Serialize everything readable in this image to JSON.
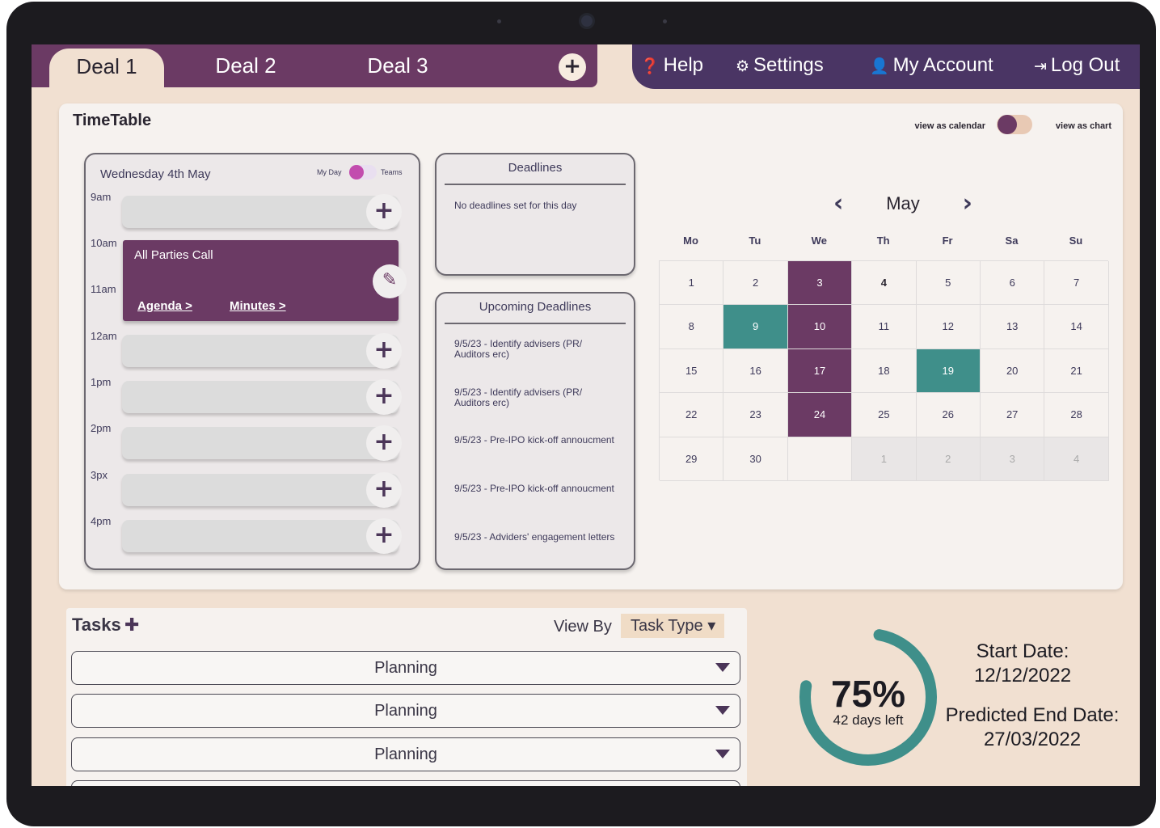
{
  "tabs": {
    "deal1": "Deal 1",
    "deal2": "Deal 2",
    "deal3": "Deal 3",
    "add": "+"
  },
  "nav": {
    "help": "Help",
    "settings": "Settings",
    "account": "My Account",
    "logout": "Log Out"
  },
  "timetable": {
    "title": "TimeTable",
    "view_calendar": "view as calendar",
    "view_chart": "view as chart"
  },
  "day": {
    "date": "Wednesday 4th May",
    "mode_left": "My Day",
    "mode_right": "Teams",
    "hours": [
      "9am",
      "10am",
      "11am",
      "12am",
      "1pm",
      "2pm",
      "3px",
      "4pm"
    ],
    "event": {
      "title": "All Parties Call",
      "agenda": "Agenda >",
      "minutes": "Minutes >"
    }
  },
  "deadlines": {
    "title": "Deadlines",
    "empty": "No deadlines set for this day"
  },
  "upcoming": {
    "title": "Upcoming Deadlines",
    "items": [
      "9/5/23 - Identify advisers (PR/ Auditors erc)",
      "9/5/23 - Identify advisers (PR/ Auditors erc)",
      "9/5/23 - Pre-IPO kick-off annoucment",
      "9/5/23 - Pre-IPO kick-off annoucment",
      "9/5/23 - Adviders' engagement letters"
    ]
  },
  "calendar": {
    "month": "May",
    "prev": "‹",
    "next": "›",
    "weekdays": [
      "Mo",
      "Tu",
      "We",
      "Th",
      "Fr",
      "Sa",
      "Su"
    ],
    "weeks": [
      [
        "1",
        "2",
        "3",
        "4",
        "5",
        "6",
        "7"
      ],
      [
        "8",
        "9",
        "10",
        "11",
        "12",
        "13",
        "14"
      ],
      [
        "15",
        "16",
        "17",
        "18",
        "19",
        "20",
        "21"
      ],
      [
        "22",
        "23",
        "24",
        "25",
        "26",
        "27",
        "28"
      ],
      [
        "29",
        "30",
        "",
        "1",
        "2",
        "3",
        "4"
      ]
    ],
    "deadline_color": "#6b3a64",
    "milestone_color": "#3f8f8a"
  },
  "tasks": {
    "title": "Tasks",
    "view_by_label": "View By",
    "view_by_value": "Task Type ▾",
    "rows": [
      "Planning",
      "Planning",
      "Planning"
    ]
  },
  "progress": {
    "percent": "75%",
    "percent_value": 0.75,
    "days_left": "42 days left",
    "start_label": "Start Date:",
    "start_value": "12/12/2022",
    "end_label": "Predicted End Date:",
    "end_value": "27/03/2022",
    "color": "#3f8f8a"
  }
}
